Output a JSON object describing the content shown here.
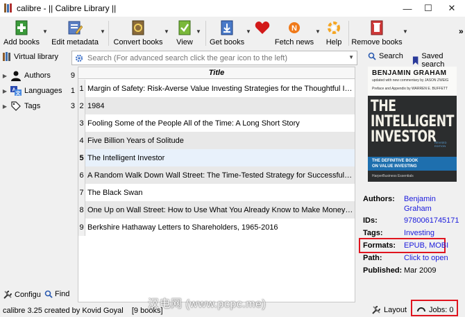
{
  "window": {
    "title": "calibre - || Calibre Library ||",
    "minimize": "—",
    "maximize": "☐",
    "close": "✕"
  },
  "toolbar": {
    "buttons": [
      {
        "label": "Add books",
        "icon": "add-books-icon"
      },
      {
        "label": "Edit metadata",
        "icon": "edit-metadata-icon"
      },
      {
        "label": "Convert books",
        "icon": "convert-books-icon"
      },
      {
        "label": "View",
        "icon": "view-icon"
      },
      {
        "label": "Get books",
        "icon": "get-books-icon"
      },
      {
        "label": "",
        "icon": "heart-icon"
      },
      {
        "label": "Fetch news",
        "icon": "fetch-news-icon"
      },
      {
        "label": "Help",
        "icon": "help-icon"
      },
      {
        "label": "Remove books",
        "icon": "remove-books-icon"
      }
    ],
    "overflow": "»"
  },
  "search": {
    "virtual_library": "Virtual library",
    "placeholder": "Search (For advanced search click the gear icon to the left)",
    "search_button": "Search",
    "saved_search": "Saved search"
  },
  "tag_browser": {
    "items": [
      {
        "label": "Authors",
        "count": "9",
        "icon": "person-icon"
      },
      {
        "label": "Languages",
        "count": "1",
        "icon": "languages-icon"
      },
      {
        "label": "Tags",
        "count": "3",
        "icon": "tag-icon"
      }
    ],
    "configure": "Configu",
    "find": "Find"
  },
  "book_list": {
    "column_title": "Title",
    "rows": [
      {
        "num": "1",
        "title": "Margin of Safety: Risk-Averse Value Investing Strategies for the Thoughtful Investor"
      },
      {
        "num": "2",
        "title": "1984"
      },
      {
        "num": "3",
        "title": "Fooling Some of the People All of the Time: A Long Short Story"
      },
      {
        "num": "4",
        "title": "Five Billion Years of Solitude"
      },
      {
        "num": "5",
        "title": "The Intelligent Investor"
      },
      {
        "num": "6",
        "title": "A Random Walk Down Wall Street: The Time-Tested Strategy for Successful Investing..."
      },
      {
        "num": "7",
        "title": "The Black Swan"
      },
      {
        "num": "8",
        "title": "One Up on Wall Street: How to Use What You Already Know to Make Money In"
      },
      {
        "num": "9",
        "title": "Berkshire Hathaway Letters to Shareholders, 1965-2016"
      }
    ],
    "selected_index": 4
  },
  "cover": {
    "author": "BENJAMIN GRAHAM",
    "sub1": "updated with new commentary by JASON ZWEIG",
    "sub2": "Preface and Appendix by WARREN E. BUFFETT",
    "title_line1": "THE",
    "title_line2": "INTELLIGENT",
    "title_line3": "INVESTOR",
    "revised": "REVISED EDITION",
    "band1": "THE DEFINITIVE BOOK",
    "band2": "ON VALUE INVESTING",
    "publisher": "HarperBusiness Essentials"
  },
  "details": {
    "authors_label": "Authors:",
    "authors_value_1": "Benjamin",
    "authors_value_2": "Graham",
    "ids_label": "IDs:",
    "ids_value": "9780061745171",
    "tags_label": "Tags:",
    "tags_value": "Investing",
    "formats_label": "Formats:",
    "formats_value": "EPUB, MOBI",
    "path_label": "Path:",
    "path_value": "Click to open",
    "published_label": "Published:",
    "published_value": "Mar 2009"
  },
  "status": {
    "text": "calibre 3.25 created by Kovid Goyal    [9 books]",
    "layout": "Layout",
    "jobs": "Jobs: 0",
    "watermark": "汉电网 (www.pcpc.me)"
  },
  "colors": {
    "highlight_red": "#e0141e",
    "link_blue": "#1a1adc",
    "selected_row": "#e8f1fb"
  }
}
